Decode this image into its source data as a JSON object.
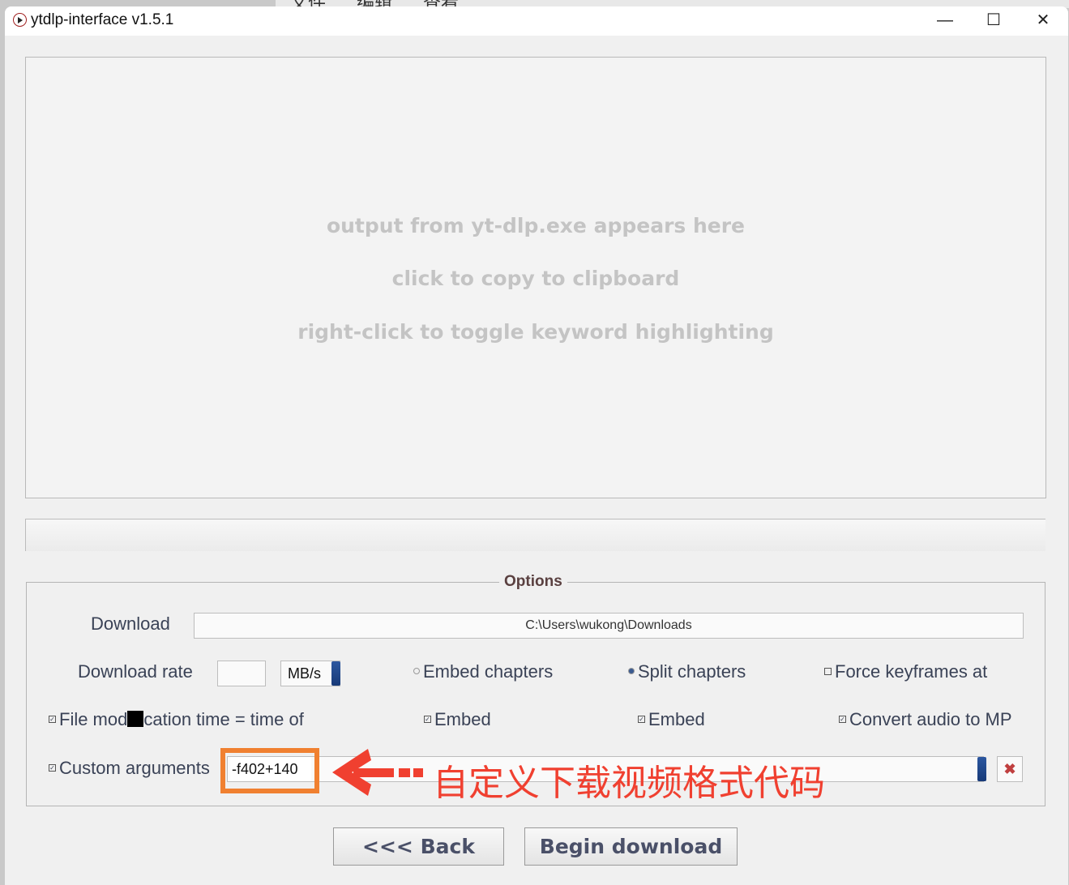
{
  "background_menu": [
    "文件",
    "编辑",
    "查看"
  ],
  "window": {
    "title": "ytdlp-interface v1.5.1",
    "controls": {
      "minimize": "—",
      "maximize": "☐",
      "close": "✕"
    }
  },
  "output": {
    "lines": [
      "output from yt-dlp.exe appears here",
      "click to copy to clipboard",
      "right-click to toggle keyword highlighting"
    ]
  },
  "options": {
    "legend": "Options",
    "download_folder_label": "Download",
    "download_folder_value": "C:\\Users\\wukong\\Downloads",
    "download_rate_label": "Download rate",
    "download_rate_value": "",
    "rate_unit": "MB/s",
    "embed_chapters": {
      "label": "Embed chapters",
      "checked": false
    },
    "split_chapters": {
      "label": "Split chapters",
      "checked": true
    },
    "force_keyframes": {
      "label": "Force keyframes at",
      "checked": false
    },
    "file_mod_time": {
      "label": "File mod",
      "label_rest": "cation time = time of",
      "checked": true
    },
    "embed1": {
      "label": "Embed",
      "checked": true
    },
    "embed2": {
      "label": "Embed",
      "checked": true
    },
    "convert_audio": {
      "label": "Convert audio to MP",
      "checked": true
    },
    "custom_arguments": {
      "label": "Custom arguments",
      "value": "-f402+140",
      "checked": true
    }
  },
  "annotation": "自定义下载视频格式代码",
  "buttons": {
    "back": "<<< Back",
    "begin": "Begin download"
  },
  "colors": {
    "accent": "#f08030",
    "annotation": "#f04030",
    "dropdown": "#1f4688"
  }
}
